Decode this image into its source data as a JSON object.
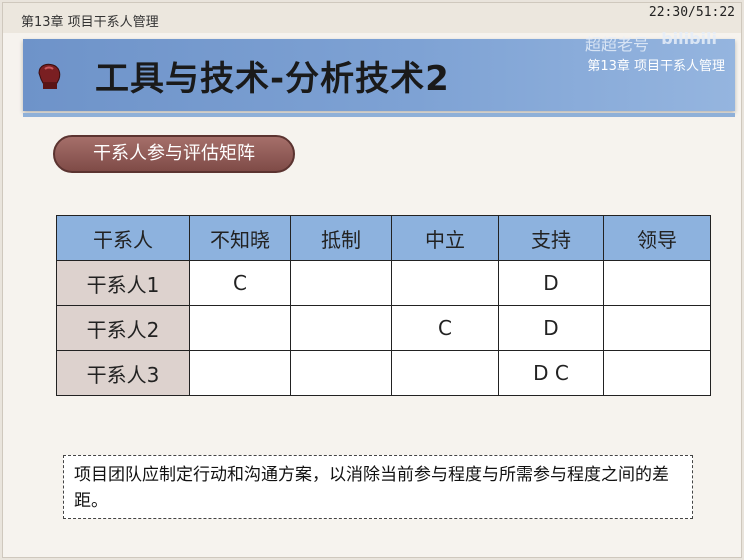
{
  "header": {
    "chapter_left": "第13章 项目干系人管理",
    "timer": "22:30/51:22"
  },
  "banner": {
    "icon": "boxing-glove-icon",
    "title": "工具与技术-分析技术2",
    "watermark": "超超老号",
    "logo": "bilibili",
    "chapter": "第13章 项目干系人管理"
  },
  "pill": {
    "label": "干系人参与评估矩阵"
  },
  "matrix": {
    "headers": [
      "干系人",
      "不知晓",
      "抵制",
      "中立",
      "支持",
      "领导"
    ],
    "rows": [
      {
        "name": "干系人1",
        "cells": [
          "C",
          "",
          "",
          "D",
          ""
        ]
      },
      {
        "name": "干系人2",
        "cells": [
          "",
          "",
          "C",
          "D",
          ""
        ]
      },
      {
        "name": "干系人3",
        "cells": [
          "",
          "",
          "",
          "D C",
          ""
        ]
      }
    ]
  },
  "note": {
    "text": "项目团队应制定行动和沟通方案，以消除当前参与程度与所需参与程度之间的差距。"
  },
  "colors": {
    "banner": "#7ea2d4",
    "pill": "#8a5652",
    "table_header": "#8db2de",
    "row_header": "#ddd2ce"
  }
}
